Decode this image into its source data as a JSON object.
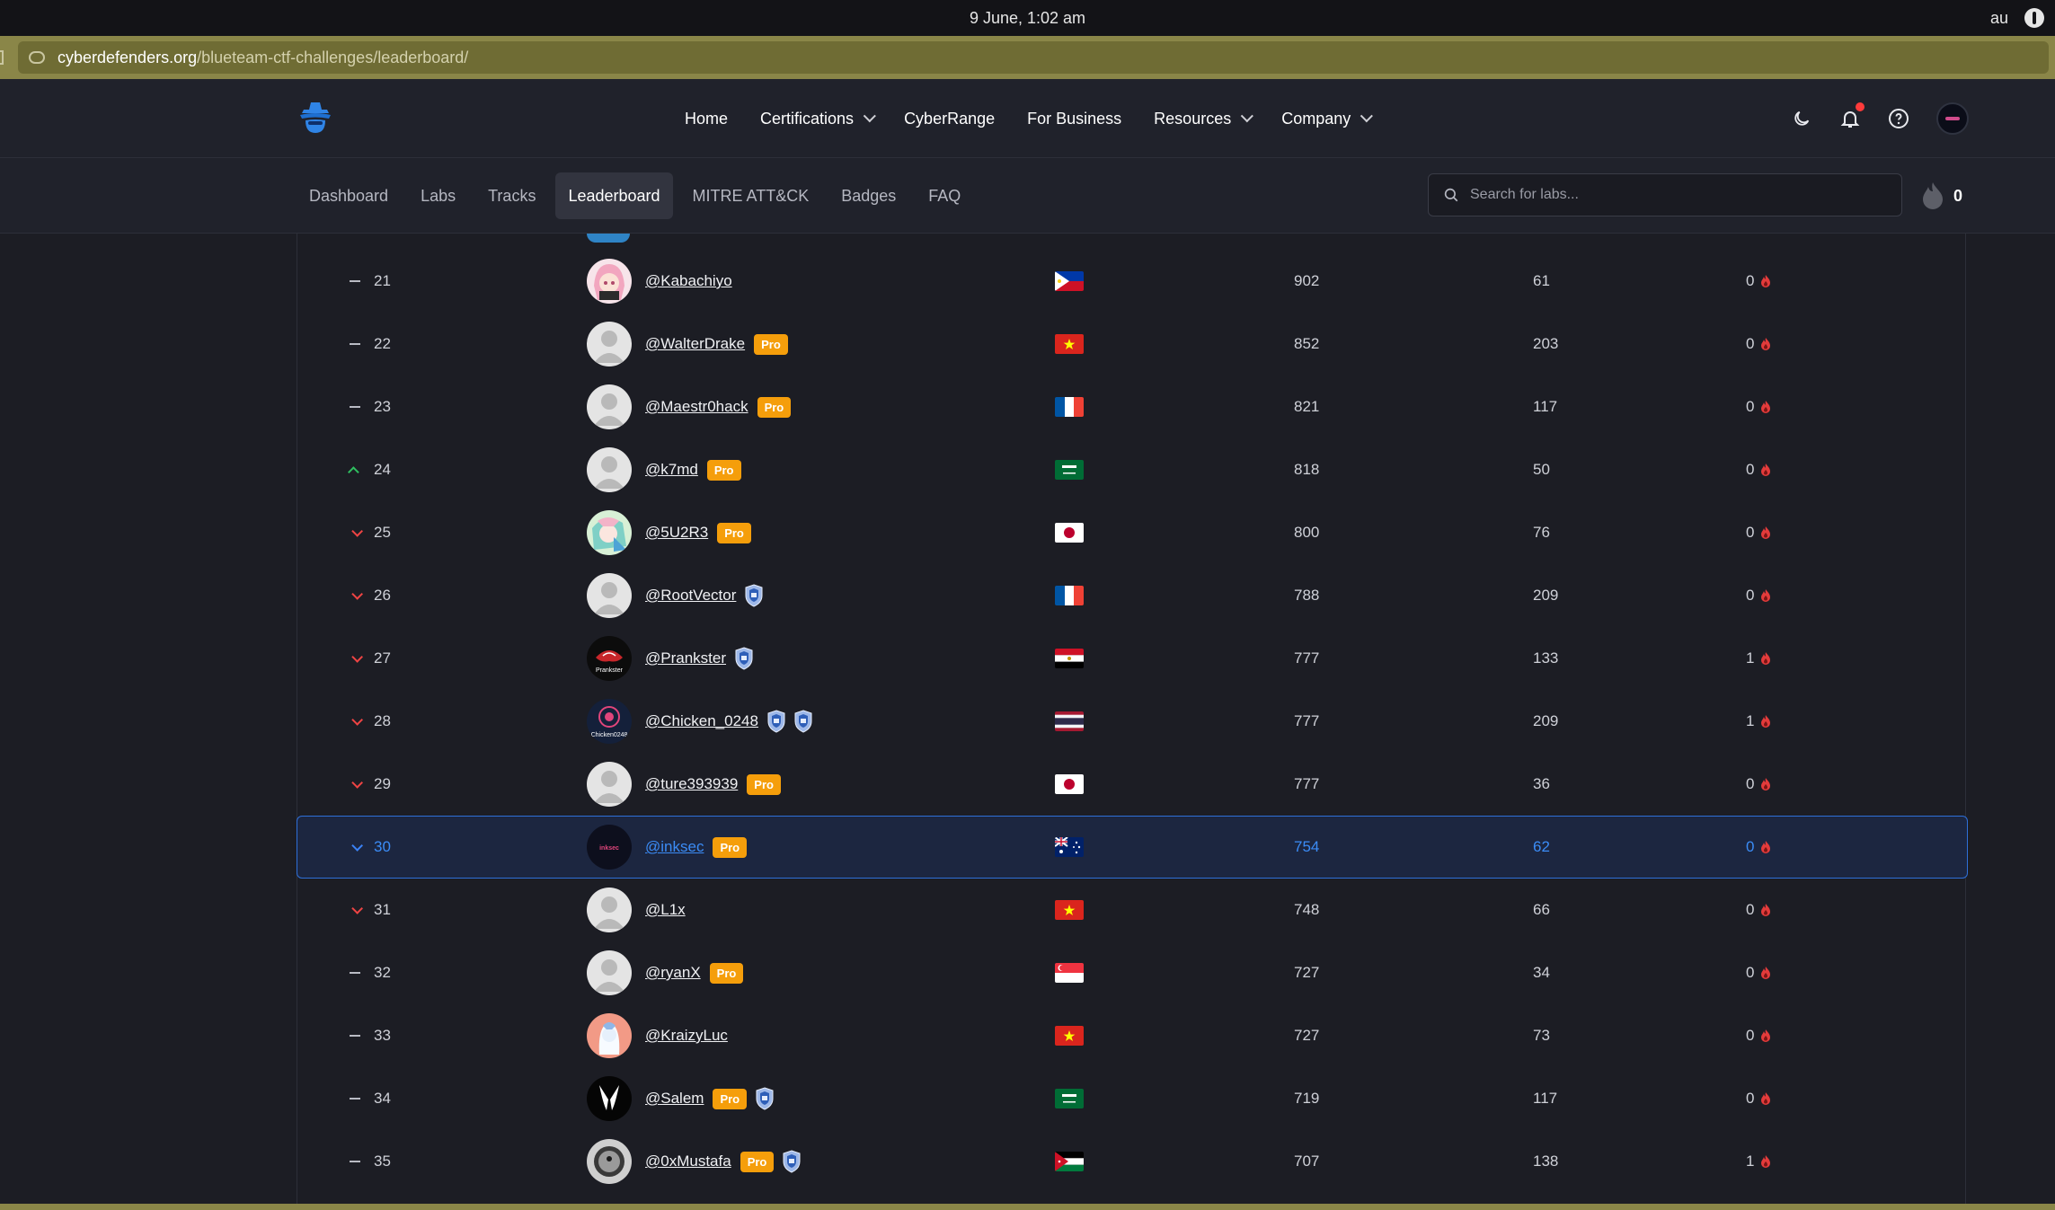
{
  "os": {
    "clock": "9 June, 1:02 am",
    "locale": "au"
  },
  "browser": {
    "url_host": "cyberdefenders.org",
    "url_path": "/blueteam-ctf-challenges/leaderboard/"
  },
  "nav": {
    "items": [
      {
        "label": "Home",
        "dropdown": false
      },
      {
        "label": "Certifications",
        "dropdown": true
      },
      {
        "label": "CyberRange",
        "dropdown": false
      },
      {
        "label": "For Business",
        "dropdown": false
      },
      {
        "label": "Resources",
        "dropdown": true
      },
      {
        "label": "Company",
        "dropdown": true
      }
    ]
  },
  "subnav": {
    "tabs": [
      "Dashboard",
      "Labs",
      "Tracks",
      "Leaderboard",
      "MITRE ATT&CK",
      "Badges",
      "FAQ"
    ],
    "active": "Leaderboard",
    "search_placeholder": "Search for labs...",
    "streak_count": "0"
  },
  "leaderboard": {
    "rows": [
      {
        "trend": "flat",
        "rank": "21",
        "username": "@Kabachiyo",
        "pro": false,
        "badges": 0,
        "avatar": "anime-pink",
        "flag": "PH",
        "points": "902",
        "labs": "61",
        "streak": "0"
      },
      {
        "trend": "flat",
        "rank": "22",
        "username": "@WalterDrake",
        "pro": true,
        "badges": 0,
        "avatar": "default",
        "flag": "VN",
        "points": "852",
        "labs": "203",
        "streak": "0"
      },
      {
        "trend": "flat",
        "rank": "23",
        "username": "@Maestr0hack",
        "pro": true,
        "badges": 0,
        "avatar": "default",
        "flag": "FR",
        "points": "821",
        "labs": "117",
        "streak": "0"
      },
      {
        "trend": "up",
        "rank": "24",
        "username": "@k7md",
        "pro": true,
        "badges": 0,
        "avatar": "default",
        "flag": "SA",
        "points": "818",
        "labs": "50",
        "streak": "0"
      },
      {
        "trend": "down",
        "rank": "25",
        "username": "@5U2R3",
        "pro": true,
        "badges": 0,
        "avatar": "anime-green",
        "flag": "JP",
        "points": "800",
        "labs": "76",
        "streak": "0"
      },
      {
        "trend": "down",
        "rank": "26",
        "username": "@RootVector",
        "pro": false,
        "badges": 1,
        "avatar": "default",
        "flag": "FR",
        "points": "788",
        "labs": "209",
        "streak": "0"
      },
      {
        "trend": "down",
        "rank": "27",
        "username": "@Prankster",
        "pro": false,
        "badges": 1,
        "avatar": "prankster",
        "flag": "EG",
        "points": "777",
        "labs": "133",
        "streak": "1"
      },
      {
        "trend": "down",
        "rank": "28",
        "username": "@Chicken_0248",
        "pro": false,
        "badges": 2,
        "avatar": "chicken",
        "flag": "TH",
        "points": "777",
        "labs": "209",
        "streak": "1"
      },
      {
        "trend": "down",
        "rank": "29",
        "username": "@ture393939",
        "pro": true,
        "badges": 0,
        "avatar": "default",
        "flag": "JP",
        "points": "777",
        "labs": "36",
        "streak": "0"
      },
      {
        "trend": "down",
        "rank": "30",
        "username": "@inksec",
        "pro": true,
        "badges": 0,
        "avatar": "inksec",
        "flag": "AU",
        "points": "754",
        "labs": "62",
        "streak": "0",
        "me": true
      },
      {
        "trend": "down",
        "rank": "31",
        "username": "@L1x",
        "pro": false,
        "badges": 0,
        "avatar": "default",
        "flag": "VN",
        "points": "748",
        "labs": "66",
        "streak": "0"
      },
      {
        "trend": "flat",
        "rank": "32",
        "username": "@ryanX",
        "pro": true,
        "badges": 0,
        "avatar": "default",
        "flag": "SG",
        "points": "727",
        "labs": "34",
        "streak": "0"
      },
      {
        "trend": "flat",
        "rank": "33",
        "username": "@KraizyLuc",
        "pro": false,
        "badges": 0,
        "avatar": "anime-salmon",
        "flag": "VN",
        "points": "727",
        "labs": "73",
        "streak": "0"
      },
      {
        "trend": "flat",
        "rank": "34",
        "username": "@Salem",
        "pro": true,
        "badges": 1,
        "avatar": "salem",
        "flag": "SA",
        "points": "719",
        "labs": "117",
        "streak": "0"
      },
      {
        "trend": "flat",
        "rank": "35",
        "username": "@0xMustafa",
        "pro": true,
        "badges": 1,
        "avatar": "camera",
        "flag": "JO",
        "points": "707",
        "labs": "138",
        "streak": "1"
      }
    ],
    "pro_label": "Pro"
  },
  "colors": {
    "accent": "#3b82f6",
    "pro": "#f59e0b",
    "up": "#2fbf60",
    "down": "#ef4444"
  }
}
